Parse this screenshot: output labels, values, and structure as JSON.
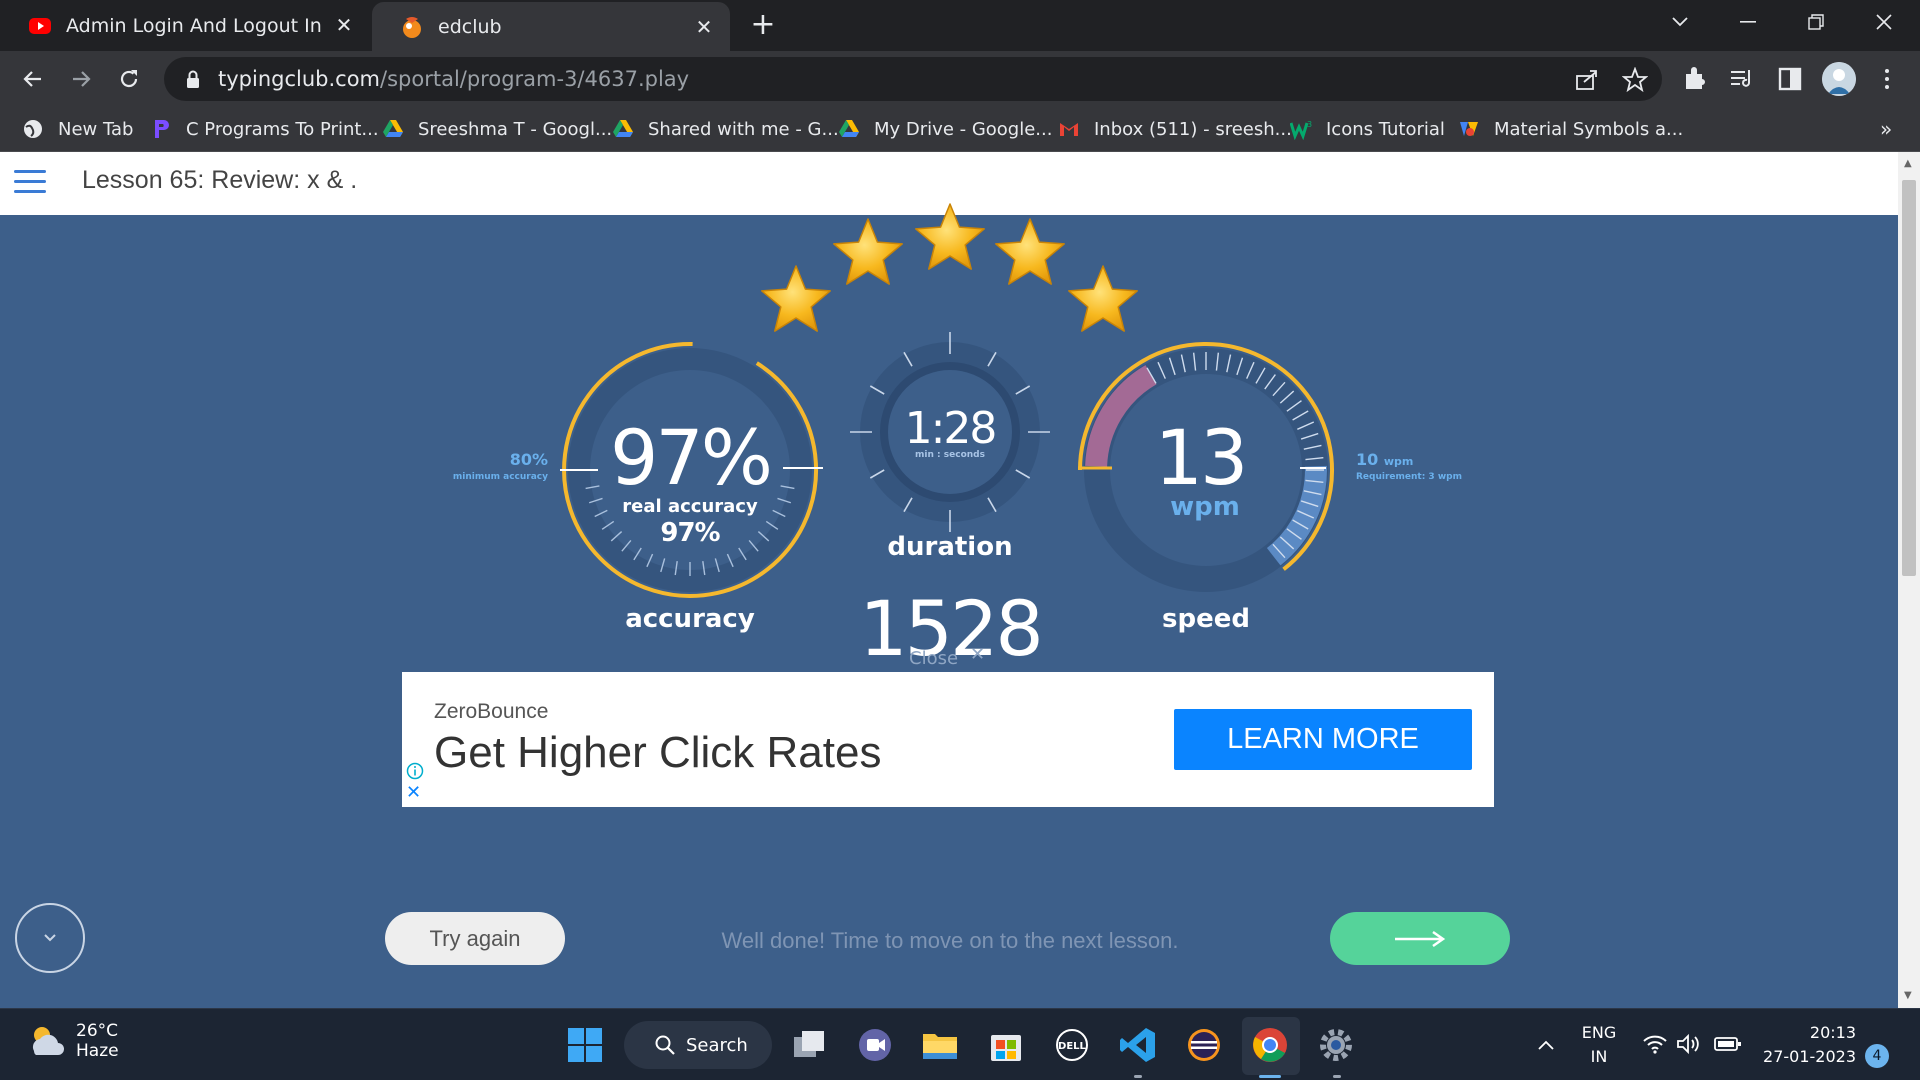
{
  "browser": {
    "tabs": [
      {
        "title": "Admin Login And Logout In User",
        "active": false,
        "favicon": "youtube-icon"
      },
      {
        "title": "edclub",
        "active": true,
        "favicon": "edclub-icon"
      }
    ],
    "address": {
      "host": "typingclub.com",
      "path": "/sportal/program-3/4637.play"
    },
    "bookmarks": [
      {
        "label": "New Tab",
        "icon": "globe-icon"
      },
      {
        "label": "C Programs To Print...",
        "icon": "bookmark-p-icon"
      },
      {
        "label": "Sreeshma T - Googl...",
        "icon": "drive-icon"
      },
      {
        "label": "Shared with me - G...",
        "icon": "drive-icon"
      },
      {
        "label": "My Drive - Google...",
        "icon": "drive-icon"
      },
      {
        "label": "Inbox (511) - sreesh...",
        "icon": "gmail-icon"
      },
      {
        "label": "Icons Tutorial",
        "icon": "w3schools-icon"
      },
      {
        "label": "Material Symbols a...",
        "icon": "material-icon"
      }
    ],
    "overflow": "»"
  },
  "page": {
    "lesson_title": "Lesson 65: Review: x & .",
    "stars": 5,
    "accuracy": {
      "value": "97%",
      "sub_label": "real accuracy",
      "sub_value": "97%",
      "label": "accuracy",
      "min_value": "80%",
      "min_label": "minimum accuracy",
      "fraction": 0.97
    },
    "duration": {
      "value": "1:28",
      "unit": "min : seconds",
      "label": "duration"
    },
    "speed": {
      "value": "13",
      "unit": "wpm",
      "label": "speed",
      "req_value": "10",
      "req_unit": "wpm",
      "req_label": "Requirement: 3 wpm"
    },
    "score": "1528",
    "close_label": "Close",
    "ad": {
      "brand": "ZeroBounce",
      "headline": "Get Higher Click Rates",
      "cta": "LEARN MORE"
    },
    "try_again": "Try again",
    "next_message": "Well done! Time to move on to the next lesson."
  },
  "taskbar": {
    "weather_temp": "26°C",
    "weather_cond": "Haze",
    "search_label": "Search",
    "lang_top": "ENG",
    "lang_bottom": "IN",
    "time": "20:13",
    "date": "27-01-2023",
    "notifications": "4"
  },
  "colors": {
    "stage": "#3d5f8a",
    "gold": "#f5b82e",
    "ad_cta": "#0a84ff",
    "next_button": "#55d39a"
  }
}
